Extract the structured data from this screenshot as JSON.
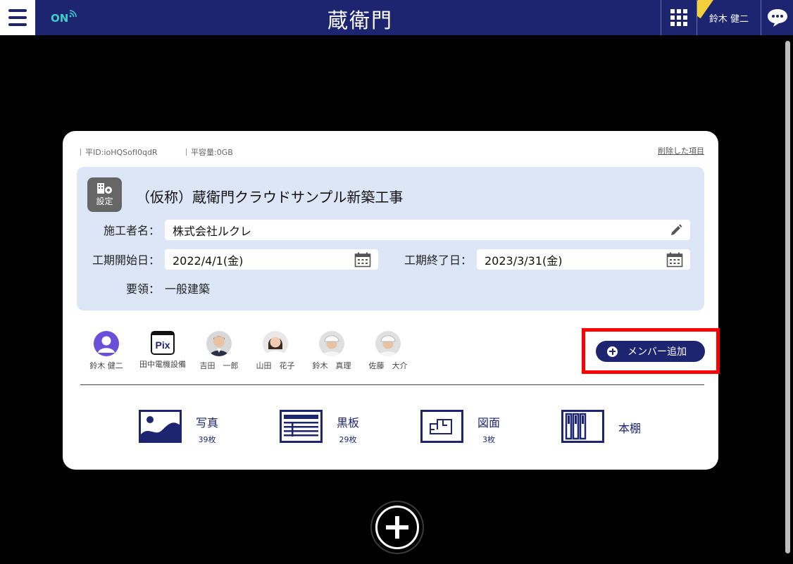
{
  "header": {
    "status": "ON",
    "logo": "蔵衛門",
    "user_name": "鈴木 健二"
  },
  "project": {
    "id_label": "平ID:ioHQSofI0qdR",
    "capacity_label": "平容量:0GB",
    "deleted_link": "削除した項目",
    "settings_label": "設定",
    "title": "（仮称）蔵衛門クラウドサンプル新築工事",
    "contractor_label": "施工者名：",
    "contractor_value": "株式会社ルクレ",
    "start_label": "工期開始日：",
    "start_value": "2022/4/1(金)",
    "end_label": "工期終了日：",
    "end_value": "2023/3/31(金)",
    "guideline_label": "要領：",
    "guideline_value": "一般建築"
  },
  "members": [
    {
      "name": "鈴木 健二"
    },
    {
      "name": "田中電機設備"
    },
    {
      "name": "吉田　一郎"
    },
    {
      "name": "山田　花子"
    },
    {
      "name": "鈴木　真理"
    },
    {
      "name": "佐藤　大介"
    }
  ],
  "add_member_label": "メンバー追加",
  "categories": [
    {
      "label": "写真",
      "count": "39枚"
    },
    {
      "label": "黒板",
      "count": "29枚"
    },
    {
      "label": "図面",
      "count": "3枚"
    },
    {
      "label": "本棚",
      "count": ""
    }
  ],
  "colors": {
    "brand": "#1d2570",
    "info_bg": "#dde6f7",
    "highlight": "#ff0000",
    "status": "#3fd0c8"
  }
}
